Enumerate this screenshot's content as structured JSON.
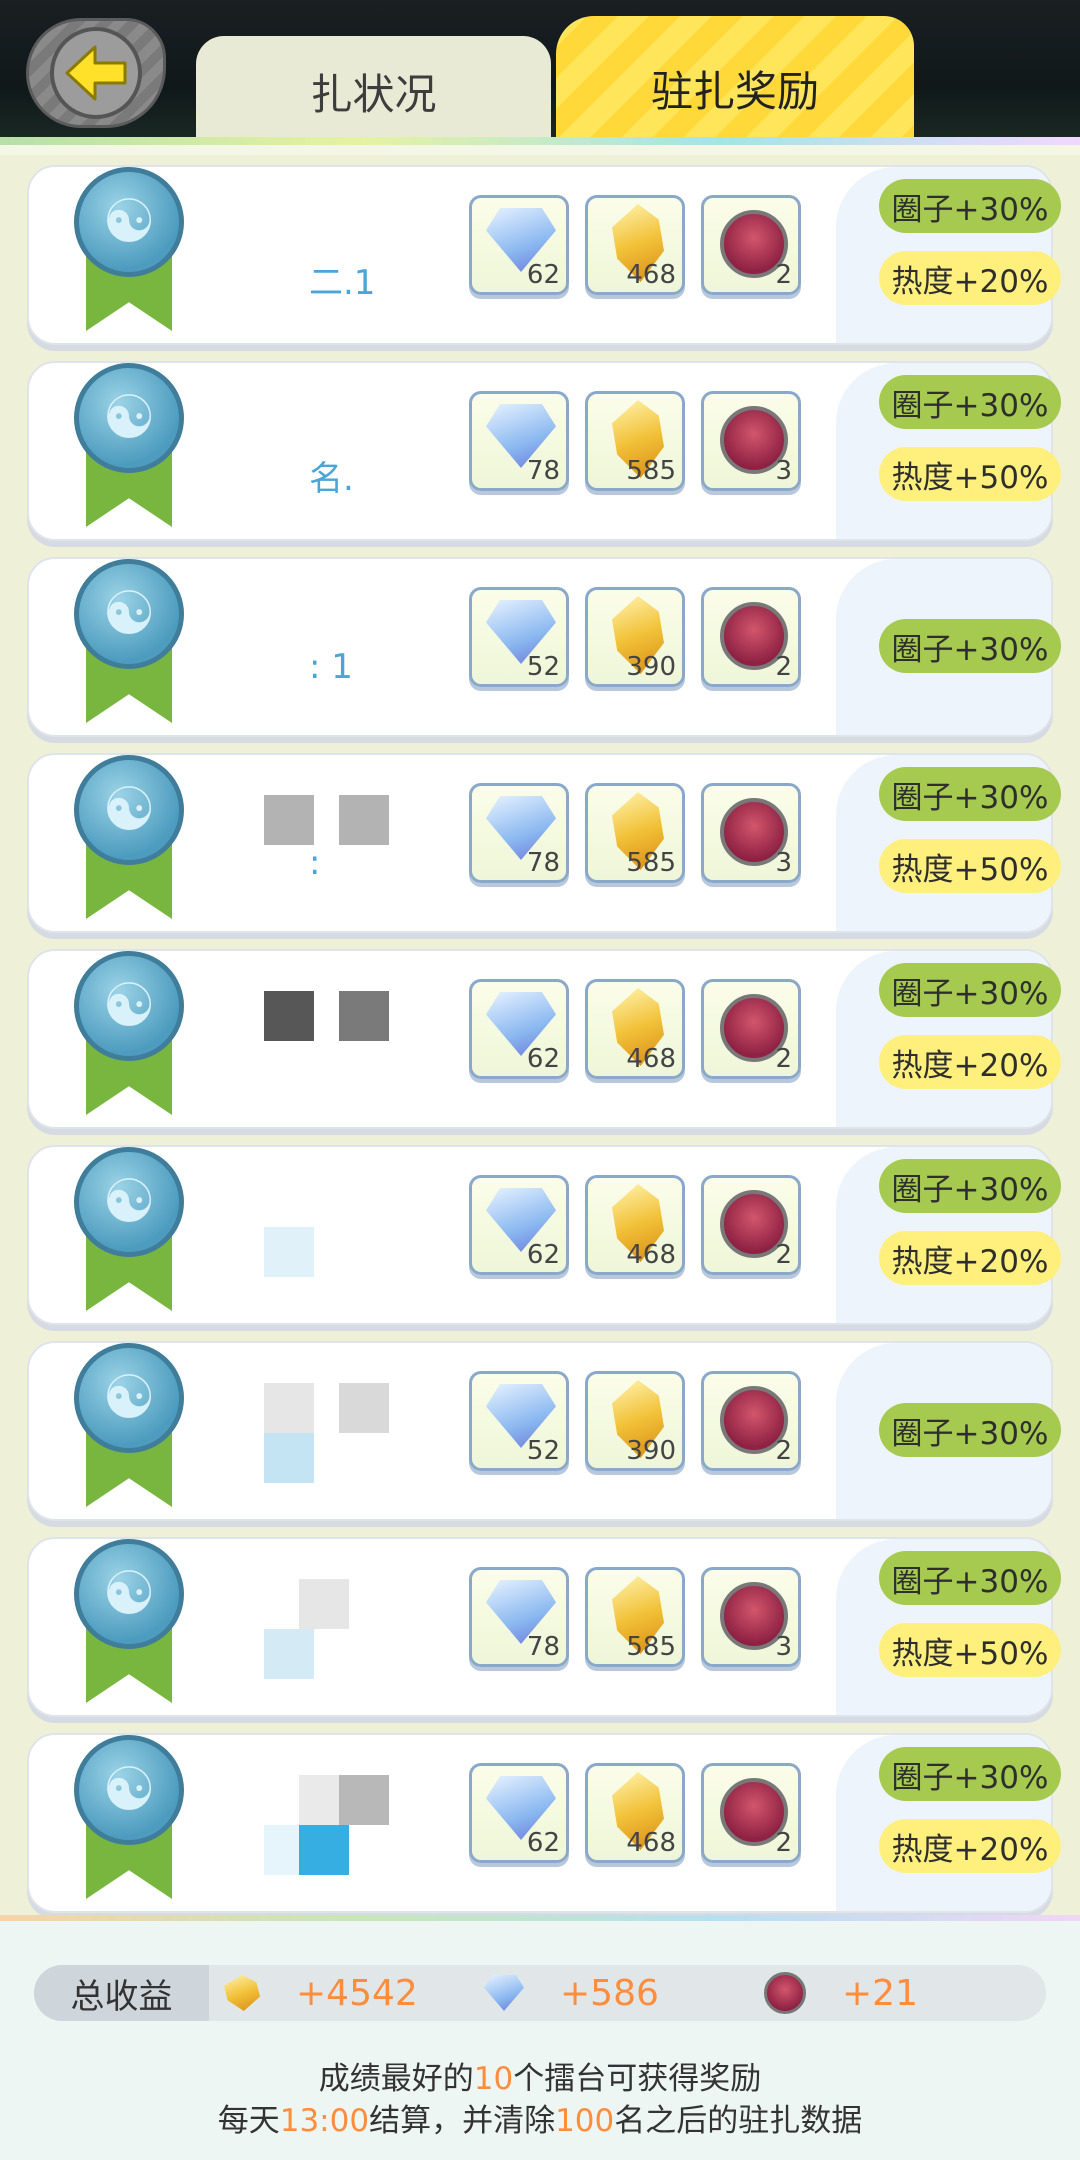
{
  "tabs": {
    "status_label": "扎状况",
    "reward_label": "驻扎奖励"
  },
  "rows": [
    {
      "name_partial": "二.1",
      "gem": "62",
      "crystal": "468",
      "beast": "2",
      "circle_bonus": "圈子+30%",
      "heat_bonus": "热度+20%"
    },
    {
      "name_partial": "名.",
      "gem": "78",
      "crystal": "585",
      "beast": "3",
      "circle_bonus": "圈子+30%",
      "heat_bonus": "热度+50%"
    },
    {
      "name_partial": ": 1",
      "gem": "52",
      "crystal": "390",
      "beast": "2",
      "circle_bonus": "圈子+30%",
      "heat_bonus": ""
    },
    {
      "name_partial": ":",
      "gem": "78",
      "crystal": "585",
      "beast": "3",
      "circle_bonus": "圈子+30%",
      "heat_bonus": "热度+50%"
    },
    {
      "name_partial": "",
      "gem": "62",
      "crystal": "468",
      "beast": "2",
      "circle_bonus": "圈子+30%",
      "heat_bonus": "热度+20%"
    },
    {
      "name_partial": "",
      "gem": "62",
      "crystal": "468",
      "beast": "2",
      "circle_bonus": "圈子+30%",
      "heat_bonus": "热度+20%"
    },
    {
      "name_partial": "",
      "gem": "52",
      "crystal": "390",
      "beast": "2",
      "circle_bonus": "圈子+30%",
      "heat_bonus": ""
    },
    {
      "name_partial": "",
      "gem": "78",
      "crystal": "585",
      "beast": "3",
      "circle_bonus": "圈子+30%",
      "heat_bonus": "热度+50%"
    },
    {
      "name_partial": "",
      "gem": "62",
      "crystal": "468",
      "beast": "2",
      "circle_bonus": "圈子+30%",
      "heat_bonus": "热度+20%"
    }
  ],
  "totals": {
    "label": "总收益",
    "crystal": "+4542",
    "gem": "+586",
    "beast": "+21"
  },
  "notes": {
    "line1_a": "成绩最好的",
    "line1_num": "10",
    "line1_b": "个擂台可获得奖励",
    "line2_a": "每天",
    "line2_time": "13:00",
    "line2_b": "结算，并清除",
    "line2_num": "100",
    "line2_c": "名之后的驻扎数据"
  },
  "colors": {
    "bonus_green": "#a6c94f",
    "bonus_yellow": "#fff07e",
    "accent_orange": "#ff8d3b",
    "medal_ribbon": "#79b63f"
  },
  "icons": [
    "back-arrow-icon",
    "medal-icon",
    "diamond-gem-icon",
    "gold-crystal-icon",
    "beast-badge-icon"
  ]
}
